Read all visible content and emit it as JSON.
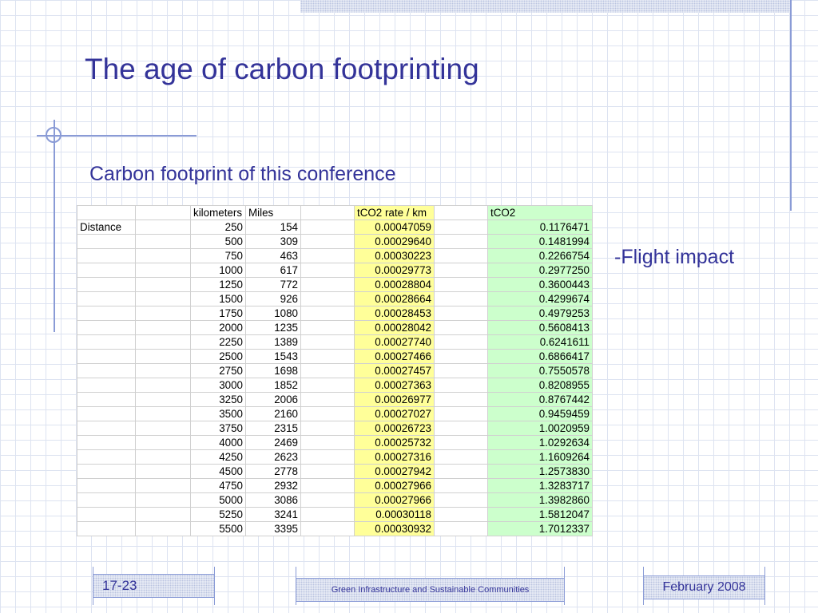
{
  "slide": {
    "title": "The age of carbon footprinting",
    "subtitle": "Carbon footprint of this conference",
    "side_note": "-Flight impact"
  },
  "table": {
    "headers": [
      "",
      "",
      "kilometers",
      "Miles",
      "",
      "tCO2 rate / km",
      "",
      "tCO2"
    ],
    "row_label": "Distance",
    "rows": [
      [
        "250",
        "154",
        "0.00047059",
        "0.1176471"
      ],
      [
        "500",
        "309",
        "0.00029640",
        "0.1481994"
      ],
      [
        "750",
        "463",
        "0.00030223",
        "0.2266754"
      ],
      [
        "1000",
        "617",
        "0.00029773",
        "0.2977250"
      ],
      [
        "1250",
        "772",
        "0.00028804",
        "0.3600443"
      ],
      [
        "1500",
        "926",
        "0.00028664",
        "0.4299674"
      ],
      [
        "1750",
        "1080",
        "0.00028453",
        "0.4979253"
      ],
      [
        "2000",
        "1235",
        "0.00028042",
        "0.5608413"
      ],
      [
        "2250",
        "1389",
        "0.00027740",
        "0.6241611"
      ],
      [
        "2500",
        "1543",
        "0.00027466",
        "0.6866417"
      ],
      [
        "2750",
        "1698",
        "0.00027457",
        "0.7550578"
      ],
      [
        "3000",
        "1852",
        "0.00027363",
        "0.8208955"
      ],
      [
        "3250",
        "2006",
        "0.00026977",
        "0.8767442"
      ],
      [
        "3500",
        "2160",
        "0.00027027",
        "0.9459459"
      ],
      [
        "3750",
        "2315",
        "0.00026723",
        "1.0020959"
      ],
      [
        "4000",
        "2469",
        "0.00025732",
        "1.0292634"
      ],
      [
        "4250",
        "2623",
        "0.00027316",
        "1.1609264"
      ],
      [
        "4500",
        "2778",
        "0.00027942",
        "1.2573830"
      ],
      [
        "4750",
        "2932",
        "0.00027966",
        "1.3283717"
      ],
      [
        "5000",
        "3086",
        "0.00027966",
        "1.3982860"
      ],
      [
        "5250",
        "3241",
        "0.00030118",
        "1.5812047"
      ],
      [
        "5500",
        "3395",
        "0.00030932",
        "1.7012337"
      ]
    ]
  },
  "footer": {
    "slide_number": "17-23",
    "center_text": "Green Infrastructure and Sustainable Communities",
    "date": "February 2008"
  },
  "colors": {
    "title": "#333399",
    "rate_column_fill": "#ffff99",
    "tco2_column_fill": "#ccffcc",
    "accent_lines": "#8a9bd6"
  }
}
